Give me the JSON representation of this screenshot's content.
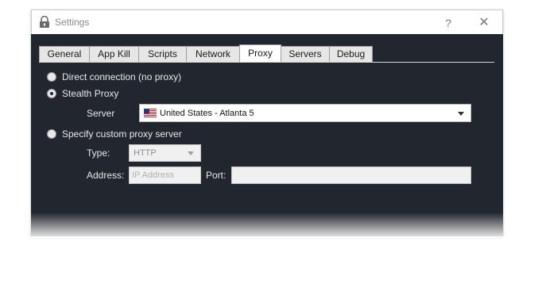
{
  "window": {
    "title": "Settings",
    "help_label": "?",
    "close_label": "✕"
  },
  "tabs": [
    {
      "label": "General"
    },
    {
      "label": "App Kill"
    },
    {
      "label": "Scripts"
    },
    {
      "label": "Network"
    },
    {
      "label": "Proxy",
      "active": true
    },
    {
      "label": "Servers"
    },
    {
      "label": "Debug"
    }
  ],
  "proxy": {
    "direct_label": "Direct connection (no proxy)",
    "stealth_label": "Stealth Proxy",
    "server_label": "Server",
    "server_value": "United States - Atlanta 5",
    "custom_label": "Specify custom proxy server",
    "type_label": "Type:",
    "type_value": "HTTP",
    "address_label": "Address:",
    "address_placeholder": "IP Address",
    "port_label": "Port:",
    "port_value": "",
    "selected_option": "Stealth Proxy"
  },
  "colors": {
    "background": "#22262e",
    "text": "#e8e8e8"
  }
}
